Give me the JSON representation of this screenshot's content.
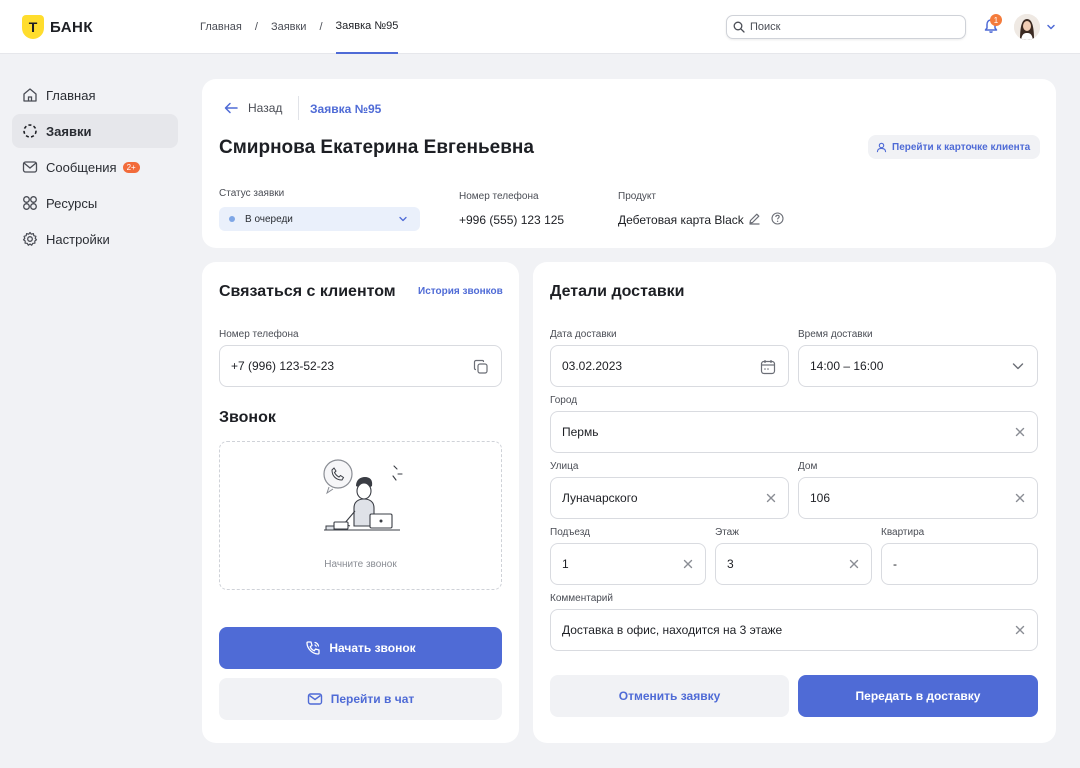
{
  "brand": {
    "name": "БАНК",
    "letter": "Т",
    "accent": "#4f6bd6",
    "logo_color": "#ffdd2d"
  },
  "breadcrumbs": [
    "Главная",
    "Заявки",
    "Заявка №95"
  ],
  "breadcrumb_separator": "/",
  "search": {
    "placeholder": "Поиск",
    "value": ""
  },
  "notifications": {
    "count": "1",
    "icon": "bell-icon"
  },
  "sidebar": {
    "items": [
      {
        "label": "Главная",
        "icon": "home-icon"
      },
      {
        "label": "Заявки",
        "icon": "loader-icon",
        "active": true
      },
      {
        "label": "Сообщения",
        "icon": "mail-icon",
        "badge": "2+"
      },
      {
        "label": "Ресурсы",
        "icon": "grid-icon"
      },
      {
        "label": "Настройки",
        "icon": "gear-icon"
      }
    ]
  },
  "request": {
    "back_label": "Назад",
    "title": "Заявка №95",
    "client_name": "Смирнова Екатерина Евгеньевна",
    "client_card_button": "Перейти к карточке клиента",
    "status_label": "Статус заявки",
    "status_value": "В очереди",
    "phone_label": "Номер телефона",
    "phone_value": "+996 (555) 123 125",
    "product_label": "Продукт",
    "product_value": "Дебетовая карта Black"
  },
  "contact": {
    "title": "Связаться с клиентом",
    "history_link": "История звонков",
    "phone_label": "Номер телефона",
    "phone_value": "+7 (996) 123-52-23",
    "call_title": "Звонок",
    "call_caption": "Начните звонок",
    "start_call_button": "Начать звонок",
    "chat_button": "Перейти в чат"
  },
  "delivery": {
    "title": "Детали доставки",
    "date_label": "Дата доставки",
    "date_value": "03.02.2023",
    "time_label": "Время доставки",
    "time_value": "14:00 – 16:00",
    "city_label": "Город",
    "city_value": "Пермь",
    "street_label": "Улица",
    "street_value": "Луначарского",
    "house_label": "Дом",
    "house_value": "106",
    "entrance_label": "Подъезд",
    "entrance_value": "1",
    "floor_label": "Этаж",
    "floor_value": "3",
    "apartment_label": "Квартира",
    "apartment_value": "-",
    "comment_label": "Комментарий",
    "comment_value": "Доставка в офис, находится на 3 этаже",
    "cancel_button": "Отменить заявку",
    "submit_button": "Передать в доставку"
  }
}
